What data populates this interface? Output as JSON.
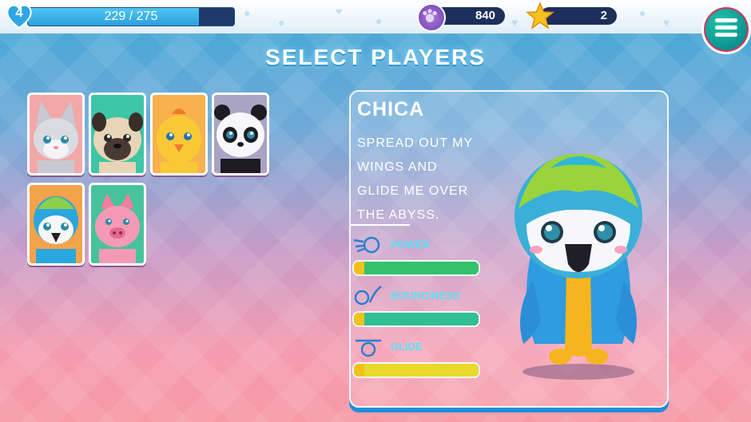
{
  "hud": {
    "level": "4",
    "xp_text": "229 / 275",
    "xp_progress": 0.83,
    "paws": "840",
    "stars": "2"
  },
  "title": "SELECT PLAYERS",
  "characters": [
    {
      "name": "cat",
      "selected": false
    },
    {
      "name": "pug",
      "selected": false
    },
    {
      "name": "chick",
      "selected": false
    },
    {
      "name": "panda",
      "selected": false
    },
    {
      "name": "parrot",
      "selected": true
    },
    {
      "name": "pig",
      "selected": false
    }
  ],
  "detail": {
    "name": "CHICA",
    "description_lines": [
      "SPREAD OUT MY",
      "WINGS AND",
      "GLIDE ME OVER",
      "THE ABYSS."
    ],
    "stats": [
      {
        "label": "POWER",
        "level": 12,
        "max": 12,
        "color": "#31c26a"
      },
      {
        "label": "BOUNCINESS",
        "level": 12,
        "max": 12,
        "color": "#2fbf90"
      },
      {
        "label": "GLIDE",
        "level": 12,
        "max": 12,
        "color": "#e9d92a"
      }
    ]
  },
  "colors": {
    "accent": "#58e1f7",
    "panel_border": "#1f8fd8",
    "hud_dark": "#1d2f5b"
  }
}
